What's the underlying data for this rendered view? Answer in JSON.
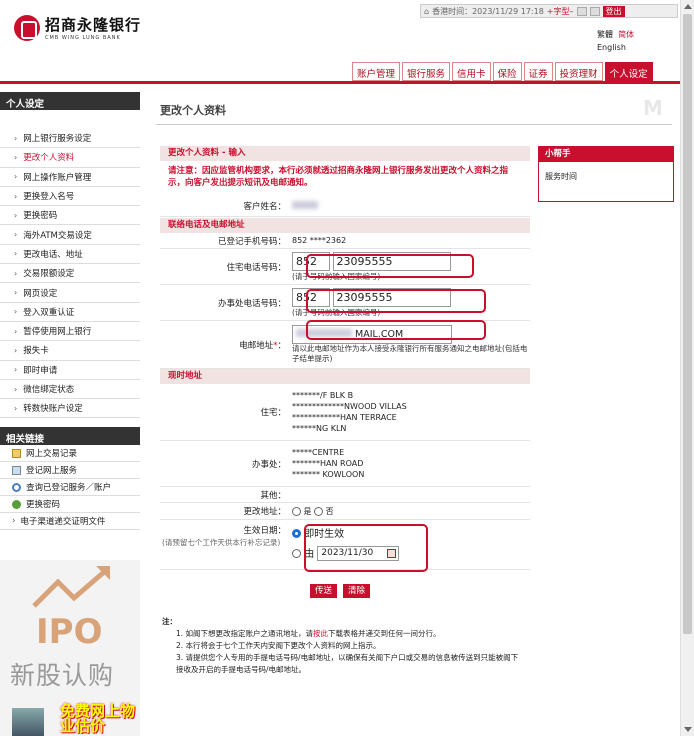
{
  "header": {
    "logo_cn": "招商永隆银行",
    "logo_en": "CMB WING LUNG BANK",
    "time_text": "香港时间：2023/11/29 17:18",
    "font_size_label": "字型",
    "logout_label": "登出",
    "lang_trad": "繁體",
    "lang_simp": "简体",
    "lang_en": "English",
    "nav_tabs": [
      "账户管理",
      "银行服务",
      "信用卡",
      "保险",
      "证券",
      "投资理财",
      "个人设定"
    ]
  },
  "sidebar": {
    "section1_title": "个人设定",
    "items": [
      "网上银行服务设定",
      "更改个人资料",
      "网上操作账户管理",
      "更换登入名号",
      "更换密码",
      "海外ATM交易设定",
      "更改电话、地址",
      "交易限额设定",
      "网页设定",
      "登入双重认证",
      "暂停使用网上银行",
      "报失卡",
      "即时申请",
      "微信绑定状态",
      "转数快账户设定"
    ],
    "section2_title": "相关链接",
    "links": [
      "网上交易记录",
      "登记网上服务",
      "查询已登记服务／账户",
      "更换密码",
      "电子渠道递交证明文件"
    ]
  },
  "promo": {
    "ipo": "IPO",
    "ipo_cn": "新股认购",
    "banner": "免费网上物业估价"
  },
  "main": {
    "page_title": "更改个人资料",
    "section_input": "更改个人资料 - 输入",
    "notice": "请注意：因应监管机构要求，本行必须就透过招商永隆网上银行服务发出更改个人资料之指示，向客户发出提示短讯及电邮通知。",
    "customer_name_label": "客户姓名：",
    "section_contact": "联络电话及电邮地址",
    "registered_mobile_label": "已登记手机号码：",
    "registered_mobile_value": "852 ****2362",
    "home_phone_label": "住宅电话号码：",
    "home_phone_code": "852",
    "home_phone_number": "23095555",
    "home_phone_hint": "(请于号码前输入国家编号)",
    "office_phone_label": "办事处电话号码：",
    "office_phone_code": "852",
    "office_phone_number": "23095555",
    "office_phone_hint": "(请于号码前输入国家编号)",
    "email_label": "电邮地址",
    "email_star": "*",
    "email_value": "MAIL.COM",
    "email_hint": "请以此电邮地址作为本人接受永隆银行所有服务通知之电邮地址(包括电子结单提示)",
    "section_address": "现时地址",
    "residential_label": "住宅：",
    "residential_lines": [
      "*******/F BLK B",
      "*************NWOOD VILLAS",
      "************HAN TERRACE",
      "******NG KLN"
    ],
    "office_label": "办事处：",
    "office_lines": [
      "*****CENTRE",
      "*******HAN ROAD",
      "******* KOWLOON"
    ],
    "other_label": "其他：",
    "change_address_label": "更改地址：",
    "yes_label": "是",
    "no_label": "否",
    "effective_date_label": "生效日期：",
    "effective_hint": "(请预留七个工作天供本行补忘记录)",
    "immediate_label": "即时生效",
    "from_label": "由",
    "from_date": "2023/11/30",
    "submit_label": "传送",
    "clear_label": "清除",
    "notes_title": "注：",
    "note1_a": "1. 如阁下想更改指定账户之通讯地址，请",
    "note1_link": "按此",
    "note1_b": "下载表格并递交到任何一间分行。",
    "note2": "2. 本行将会于七个工作天内安阁下更改个人资料的网上指示。",
    "note3": "3. 请提供您个人专用的手提电话号码/电邮地址，以确保有关阁下户口或交易的信息被传送到只能被阁下接收及开启的手提电话号码/电邮地址。"
  },
  "helper": {
    "title": "小帮手",
    "item": "服务时间"
  }
}
